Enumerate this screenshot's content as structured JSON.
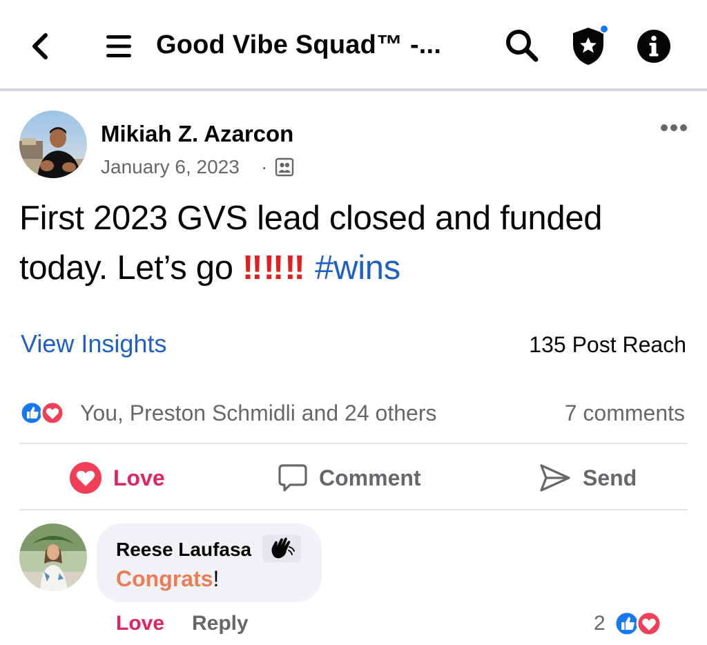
{
  "header": {
    "title": "Good Vibe Squad™ -...",
    "icons": [
      "back-icon",
      "menu-icon",
      "search-icon",
      "admin-shield-icon",
      "info-icon"
    ]
  },
  "post": {
    "author": "Mikiah Z. Azarcon",
    "date": "January 6, 2023",
    "meta_separator": "·",
    "text_main": "First 2023 GVS lead closed and funded today. Let’s go",
    "text_emphasis": "‼‼‼",
    "hashtag": "#wins",
    "insights_label": "View Insights",
    "reach": "135 Post Reach",
    "reactors": "You, Preston Schmidli and 24 others",
    "comments_count": "7 comments",
    "actions": {
      "love": "Love",
      "comment": "Comment",
      "send": "Send"
    }
  },
  "comment": {
    "author": "Reese Laufasa",
    "text_highlight": "Congrats",
    "text_rest": "!",
    "love": "Love",
    "reply": "Reply",
    "reaction_count": "2"
  },
  "colors": {
    "link_blue": "#1d5fc4",
    "love_red": "#e0245e",
    "like_blue": "#1877f2",
    "secondary_text": "#65676b"
  }
}
